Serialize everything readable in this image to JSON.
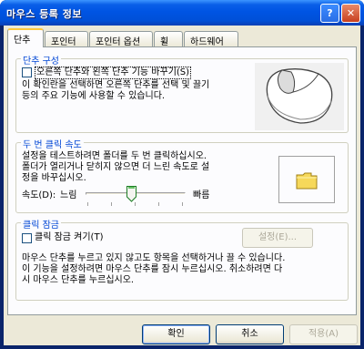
{
  "window": {
    "title": "마우스 등록 정보"
  },
  "tabs": [
    {
      "label": "단추"
    },
    {
      "label": "포인터"
    },
    {
      "label": "포인터 옵션"
    },
    {
      "label": "휠"
    },
    {
      "label": "하드웨어"
    }
  ],
  "buttons_group": {
    "label": "단추 구성",
    "checkbox_label": "오른쪽 단추와 왼쪽 단추 기능 바꾸기(S)",
    "checkbox_checked": false,
    "description_line1": "이 확인란을 선택하면 오른쪽 단추를 선택 및 끌기",
    "description_line2": "등의 주요 기능에 사용할 수 있습니다."
  },
  "double_click_group": {
    "label": "두 번 클릭 속도",
    "description_line1": "설정을 테스트하려면 폴더를 두 번 클릭하십시오.",
    "description_line2": "폴더가 열리거나 닫히지 않으면 더 느린 속도로 설",
    "description_line3": "정을 바꾸십시오.",
    "speed_label": "속도(D):",
    "slow_label": "느림",
    "fast_label": "빠름",
    "speed_value": 0.45
  },
  "clicklock_group": {
    "label": "클릭 잠금",
    "checkbox_label": "클릭 잠금 켜기(T)",
    "checkbox_checked": false,
    "settings_button": "설정(E)...",
    "description_line1": "마우스 단추를 누르고 있지 않고도 항목을 선택하거나 끌 수 있습니다.",
    "description_line2": "이 기능을 설정하려면 마우스 단추를 잠시 누르십시오. 취소하려면 다",
    "description_line3": "시 마우스 단추를 누르십시오."
  },
  "footer": {
    "ok": "확인",
    "cancel": "취소",
    "apply": "적용(A)"
  },
  "colors": {
    "accent": "#0046d5",
    "titlebar": "#0054e3",
    "face": "#ece9d8"
  }
}
